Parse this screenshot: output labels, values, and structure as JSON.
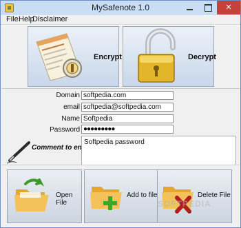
{
  "window": {
    "title": "MySafenote 1.0"
  },
  "menu": {
    "file": "File",
    "help": "Help",
    "disclaimer": "Disclaimer"
  },
  "actions": {
    "encrypt": "Encrypt",
    "decrypt": "Decrypt"
  },
  "form": {
    "domain_label": "Domain",
    "domain_value": "softpedia.com",
    "email_label": "email",
    "email_value": "softpedia@softpedia.com",
    "name_label": "Name",
    "name_value": "Softpedia",
    "password_label": "Password",
    "password_value": "●●●●●●●●●",
    "comment_label": "Comment to entry",
    "comment_value": "Softpedia password"
  },
  "file_actions": {
    "open": "Open File",
    "add": "Add to file",
    "delete": "Delete File"
  },
  "watermark": "SOFTPEDIA",
  "colors": {
    "titlebar": "#c9ddf5",
    "close": "#c7413b",
    "button_border": "#9aa6b8"
  }
}
